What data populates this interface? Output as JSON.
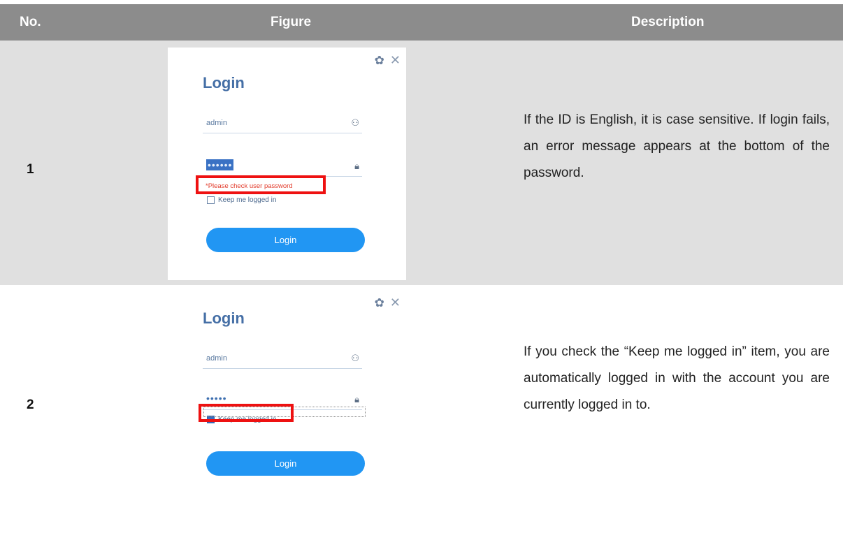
{
  "header": {
    "no": "No.",
    "figure": "Figure",
    "description": "Description"
  },
  "rows": [
    {
      "no": "1",
      "figure": {
        "title": "Login",
        "id_value": "admin",
        "password_mask": "••••••",
        "error_text": "*Please check user password",
        "keep_label": "Keep me logged in",
        "keep_checked": false,
        "button_label": "Login"
      },
      "description": "If the ID is English, it is case sensitive. If login fails, an error message appears at the bottom of the password."
    },
    {
      "no": "2",
      "figure": {
        "title": "Login",
        "id_value": "admin",
        "password_mask": "•••••",
        "keep_label": "Keep me logged in",
        "keep_checked": true,
        "button_label": "Login"
      },
      "description": "If you check the “Keep me logged in” item, you are automatically logged in with the account you are currently logged in to."
    }
  ],
  "icons": {
    "settings": "gear-icon",
    "close": "close-icon",
    "user": "user-icon",
    "lock": "lock-icon"
  },
  "colors": {
    "header_bg": "#8c8c8c",
    "row1_bg": "#e0e0e0",
    "highlight": "#ee1111",
    "button": "#2196f3"
  }
}
